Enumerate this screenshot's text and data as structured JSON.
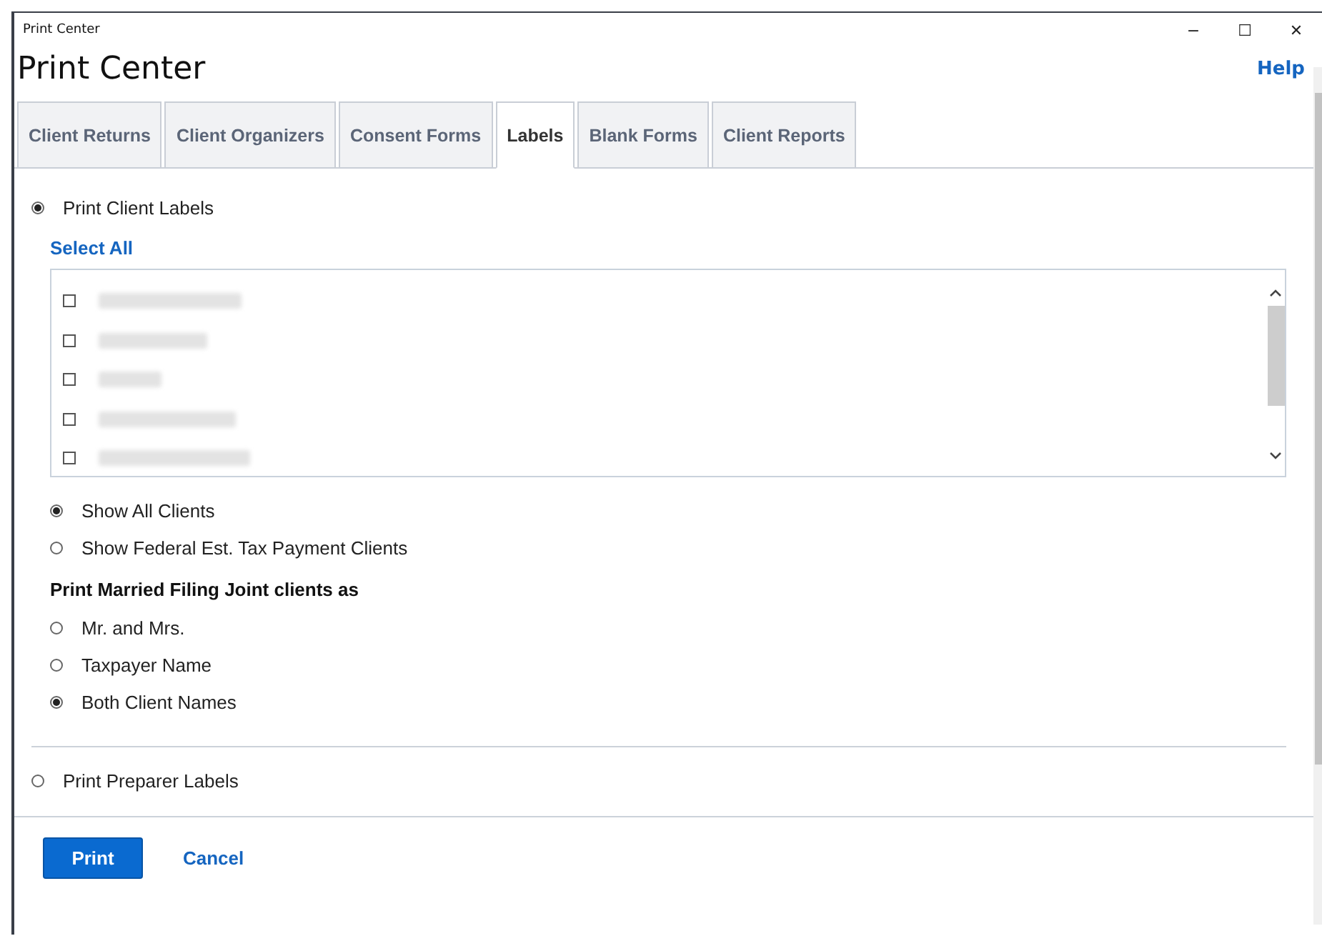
{
  "window": {
    "title": "Print Center",
    "controls": [
      "−",
      "☐",
      "✕"
    ]
  },
  "header": {
    "title": "Print Center",
    "help": "Help"
  },
  "tabs": [
    {
      "label": "Client Returns",
      "selected": false
    },
    {
      "label": "Client Organizers",
      "selected": false
    },
    {
      "label": "Consent Forms",
      "selected": false
    },
    {
      "label": "Labels",
      "selected": true
    },
    {
      "label": "Blank Forms",
      "selected": false
    },
    {
      "label": "Client Reports",
      "selected": false
    }
  ],
  "client_labels": {
    "label": "Print Client Labels",
    "selected": true,
    "select_all": "Select All",
    "clients": [
      {
        "checked": false
      },
      {
        "checked": false
      },
      {
        "checked": false
      },
      {
        "checked": false
      },
      {
        "checked": false
      }
    ],
    "filter": [
      {
        "label": "Show All Clients",
        "selected": true
      },
      {
        "label": "Show Federal Est. Tax Payment Clients",
        "selected": false
      }
    ],
    "mfj_heading": "Print Married Filing Joint clients as",
    "mfj_options": [
      {
        "label": "Mr. and Mrs.",
        "selected": false
      },
      {
        "label": "Taxpayer Name",
        "selected": false
      },
      {
        "label": "Both Client Names",
        "selected": true
      }
    ]
  },
  "preparer_labels": {
    "label": "Print Preparer Labels",
    "selected": false
  },
  "buttons": {
    "print": "Print",
    "cancel": "Cancel"
  }
}
